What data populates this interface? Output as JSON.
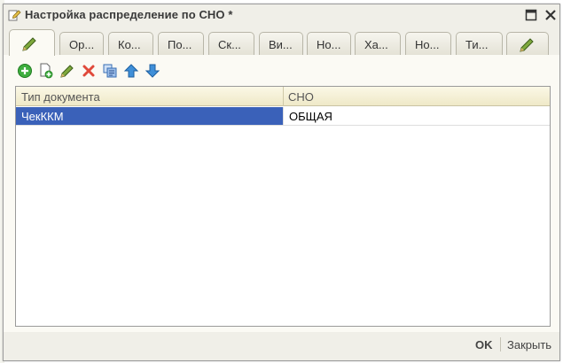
{
  "window": {
    "title": "Настройка распределение по СНО *",
    "maximize_icon": "maximize-icon",
    "close_icon": "close-icon"
  },
  "tabs": [
    {
      "label": "",
      "icon": "pencil-icon",
      "active": true
    },
    {
      "label": "Ор..."
    },
    {
      "label": "Ко..."
    },
    {
      "label": "По..."
    },
    {
      "label": "Ск..."
    },
    {
      "label": "Ви..."
    },
    {
      "label": "Но..."
    },
    {
      "label": "Ха..."
    },
    {
      "label": "Но..."
    },
    {
      "label": "Ти..."
    },
    {
      "label": "",
      "icon": "pencil-icon"
    }
  ],
  "toolbar": {
    "icons": [
      "add-icon",
      "copy-icon",
      "edit-icon",
      "delete-icon",
      "settings-icon",
      "move-up-icon",
      "move-down-icon"
    ]
  },
  "grid": {
    "columns": [
      "Тип документа",
      "СНО"
    ],
    "rows": [
      {
        "doc_type": "ЧекККМ",
        "sno": "ОБЩАЯ",
        "selected": true
      }
    ]
  },
  "footer": {
    "ok_label": "OK",
    "close_label": "Закрыть"
  },
  "colors": {
    "selection": "#3a61b9",
    "window_bg": "#f0efe8",
    "header_bg": "#f6f1d9"
  }
}
